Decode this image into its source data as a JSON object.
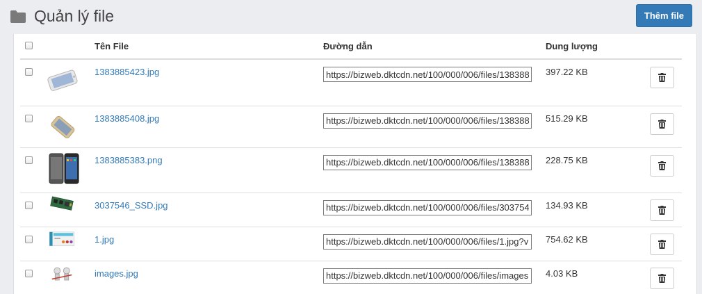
{
  "header": {
    "icon": "folder-icon",
    "title": "Quản lý file",
    "add_button": "Thêm file"
  },
  "table": {
    "columns": {
      "name": "Tên File",
      "path": "Đường dẫn",
      "size": "Dung lượng"
    },
    "rows": [
      {
        "thumb": "white-iphone-thumbnail",
        "name": "1383885423.jpg",
        "path": "https://bizweb.dktcdn.net/100/000/006/files/138388",
        "size": "397.22 KB"
      },
      {
        "thumb": "gold-iphone-thumbnail",
        "name": "1383885408.jpg",
        "path": "https://bizweb.dktcdn.net/100/000/006/files/138388",
        "size": "515.29 KB"
      },
      {
        "thumb": "black-iphones-thumbnail",
        "name": "1383885383.png",
        "path": "https://bizweb.dktcdn.net/100/000/006/files/138388",
        "size": "228.75 KB"
      },
      {
        "thumb": "ssd-board-thumbnail",
        "name": "3037546_SSD.jpg",
        "path": "https://bizweb.dktcdn.net/100/000/006/files/303754",
        "size": "134.93 KB"
      },
      {
        "thumb": "banner-thumbnail",
        "name": "1.jpg",
        "path": "https://bizweb.dktcdn.net/100/000/006/files/1.jpg?v",
        "size": "754.62 KB"
      },
      {
        "thumb": "figures-thumbnail",
        "name": "images.jpg",
        "path": "https://bizweb.dktcdn.net/100/000/006/files/images",
        "size": "4.03 KB"
      }
    ],
    "delete_icon": "trash-icon"
  },
  "colors": {
    "primary": "#337ab7",
    "link": "#337ab7",
    "background": "#ecedf0"
  }
}
